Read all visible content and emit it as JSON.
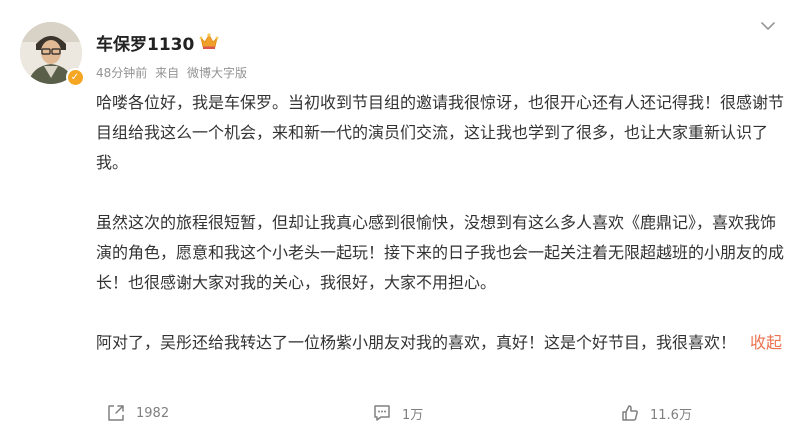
{
  "user": {
    "name": "车保罗1130",
    "avatar_icon": "avatar-photo",
    "crown_icon": "crown-icon",
    "verified_icon": "verified-badge-icon"
  },
  "meta": {
    "time": "48分钟前",
    "source_prefix": "来自",
    "source": "微博大字版"
  },
  "post": {
    "line1": "哈喽各位好，我是车保罗。当初收到节目组的邀请我很惊讶，也很开心还有人还记得我！很感谢节目组给我这么一个机会，来和新一代的演员们交流，这让我也学到了很多，也让大家重新认识了我。",
    "line2": "虽然这次的旅程很短暂，但却让我真心感到很愉快，没想到有这么多人喜欢《鹿鼎记》，喜欢我饰演的角色，愿意和我这个小老头一起玩！接下来的日子我也会一起关注着无限超越班的小朋友的成长！也很感谢大家对我的关心，我很好，大家不用担心。",
    "line3": "阿对了，吴彤还给我转达了一位杨紫小朋友对我的喜欢，真好！这是个好节目，我很喜欢！",
    "collapse_label": "收起"
  },
  "actions": {
    "repost_count": "1982",
    "comment_count": "1万",
    "like_count": "11.6万"
  },
  "colors": {
    "accent": "#eb7350",
    "meta": "#939393",
    "text": "#333333",
    "badge": "#f5a623"
  }
}
